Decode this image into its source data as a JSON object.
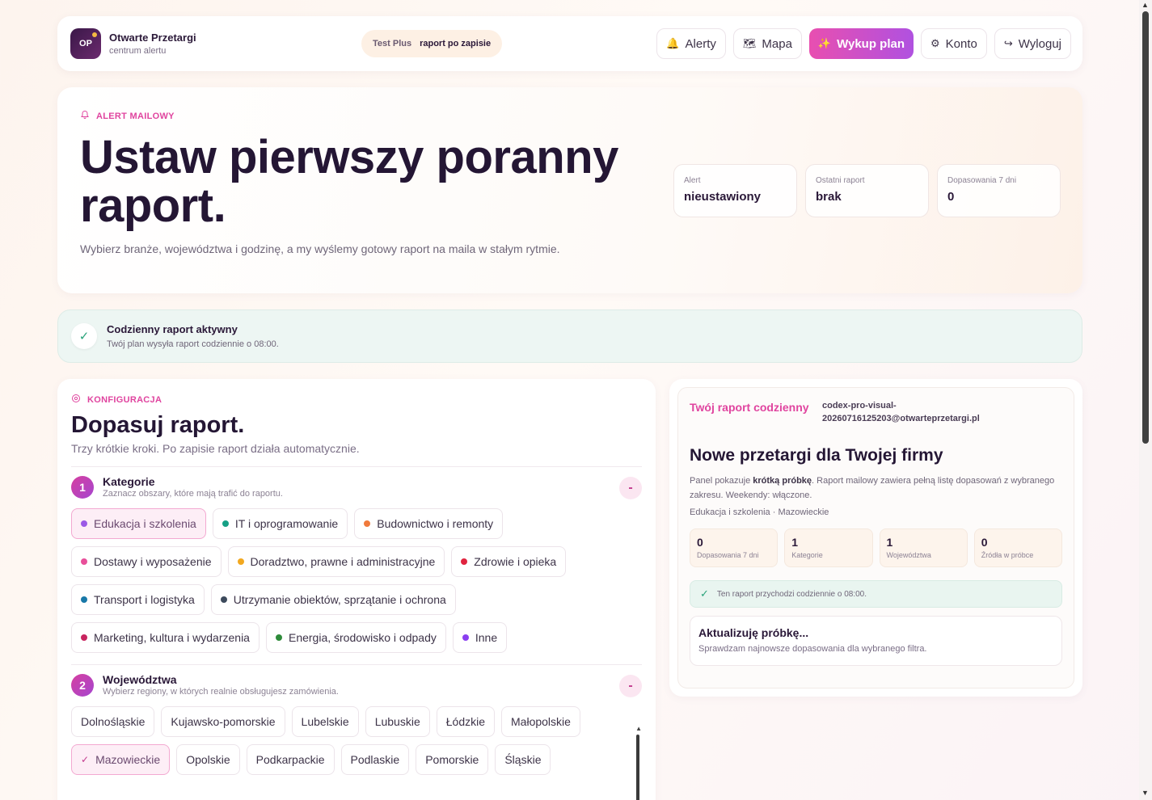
{
  "brand": {
    "name": "Otwarte Przetargi",
    "sub": "centrum alertu",
    "logo": "OP"
  },
  "plan": {
    "name": "Test Plus",
    "note": "raport po zapisie"
  },
  "nav": [
    {
      "label": "Alerty",
      "icon": "🔔",
      "iconName": "bell-icon",
      "key": "alerts"
    },
    {
      "label": "Mapa",
      "icon": "🗺",
      "iconName": "map-icon",
      "key": "map"
    },
    {
      "label": "Wykup plan",
      "icon": "✨",
      "iconName": "sparkle-icon",
      "key": "buy-plan"
    },
    {
      "label": "Konto",
      "icon": "⚙",
      "iconName": "gear-icon",
      "key": "account"
    },
    {
      "label": "Wyloguj",
      "icon": "↪",
      "iconName": "logout-icon",
      "key": "logout"
    }
  ],
  "hero": {
    "eyebrow": "ALERT MAILOWY",
    "title": "Ustaw pierwszy poranny raport.",
    "desc": "Wybierz branże, województwa i godzinę, a my wyślemy gotowy raport na maila w stałym rytmie.",
    "stats": [
      {
        "label": "Alert",
        "value": "nieustawiony"
      },
      {
        "label": "Ostatni raport",
        "value": "brak"
      },
      {
        "label": "Dopasowania 7 dni",
        "value": "0"
      }
    ]
  },
  "banner": {
    "title": "Codzienny raport aktywny",
    "sub": "Twój plan wysyła raport codziennie o 08:00."
  },
  "config": {
    "eyebrow": "KONFIGURACJA",
    "title": "Dopasuj raport.",
    "sub": "Trzy krótkie kroki. Po zapisie raport działa automatycznie.",
    "step1": {
      "num": "1",
      "title": "Kategorie",
      "sub": "Zaznacz obszary, które mają trafić do raportu.",
      "toggle": "-"
    },
    "categories": [
      {
        "label": "Edukacja i szkolenia",
        "color": "#9b59e6",
        "selected": true
      },
      {
        "label": "IT i oprogramowanie",
        "color": "#16a085",
        "selected": false
      },
      {
        "label": "Budownictwo i remonty",
        "color": "#f07a3c",
        "selected": false
      },
      {
        "label": "Dostawy i wyposażenie",
        "color": "#e84f9a",
        "selected": false
      },
      {
        "label": "Doradztwo, prawne i administracyjne",
        "color": "#f2a81f",
        "selected": false
      },
      {
        "label": "Zdrowie i opieka",
        "color": "#e0243f",
        "selected": false
      },
      {
        "label": "Transport i logistyka",
        "color": "#1878a8",
        "selected": false
      },
      {
        "label": "Utrzymanie obiektów, sprzątanie i ochrona",
        "color": "#3d4a5c",
        "selected": false
      },
      {
        "label": "Marketing, kultura i wydarzenia",
        "color": "#c8245f",
        "selected": false
      },
      {
        "label": "Energia, środowisko i odpady",
        "color": "#2e8b3a",
        "selected": false
      },
      {
        "label": "Inne",
        "color": "#8a3ff0",
        "selected": false
      }
    ],
    "step2": {
      "num": "2",
      "title": "Województwa",
      "sub": "Wybierz regiony, w których realnie obsługujesz zamówienia.",
      "toggle": "-"
    },
    "regions": [
      {
        "label": "Dolnośląskie",
        "selected": false
      },
      {
        "label": "Kujawsko-pomorskie",
        "selected": false
      },
      {
        "label": "Lubelskie",
        "selected": false
      },
      {
        "label": "Lubuskie",
        "selected": false
      },
      {
        "label": "Łódzkie",
        "selected": false
      },
      {
        "label": "Małopolskie",
        "selected": false
      },
      {
        "label": "Mazowieckie",
        "selected": true
      },
      {
        "label": "Opolskie",
        "selected": false
      },
      {
        "label": "Podkarpackie",
        "selected": false
      },
      {
        "label": "Podlaskie",
        "selected": false
      },
      {
        "label": "Pomorskie",
        "selected": false
      },
      {
        "label": "Śląskie",
        "selected": false
      }
    ]
  },
  "preview": {
    "label": "Twój raport codzienny",
    "email": "codex-pro-visual-20260716125203@otwarteprzetargi.pl",
    "title": "Nowe przetargi dla Twojej firmy",
    "desc_pre": "Panel pokazuje ",
    "desc_bold": "krótką próbkę",
    "desc_post": ". Raport mailowy zawiera pełną listę dopasowań z wybranego zakresu. Weekendy: włączone.",
    "filter": "Edukacja i szkolenia · Mazowieckie",
    "stats": [
      {
        "value": "0",
        "label": "Dopasowania 7 dni"
      },
      {
        "value": "1",
        "label": "Kategorie"
      },
      {
        "value": "1",
        "label": "Województwa"
      },
      {
        "value": "0",
        "label": "Źródła w próbce"
      }
    ],
    "schedule": "Ten raport przychodzi codziennie o 08:00.",
    "update_title": "Aktualizuję próbkę...",
    "update_sub": "Sprawdzam najnowsze dopasowania dla wybranego filtra."
  }
}
